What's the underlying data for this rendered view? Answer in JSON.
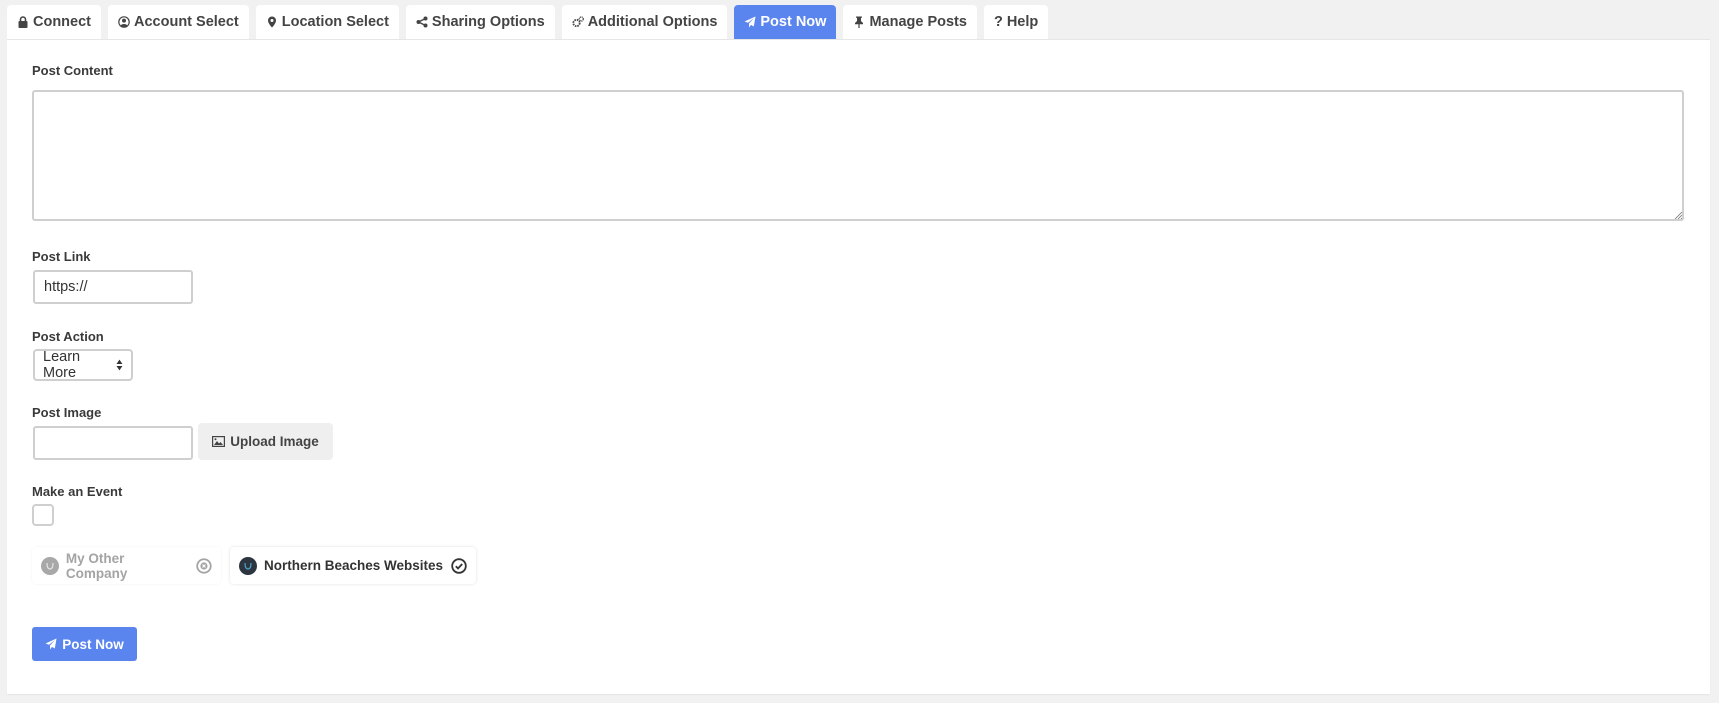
{
  "tabs": [
    {
      "label": "Connect",
      "icon": "lock-icon",
      "active": false
    },
    {
      "label": "Account Select",
      "icon": "user-circle-icon",
      "active": false
    },
    {
      "label": "Location Select",
      "icon": "map-marker-icon",
      "active": false
    },
    {
      "label": "Sharing Options",
      "icon": "share-icon",
      "active": false
    },
    {
      "label": "Additional Options",
      "icon": "cogs-icon",
      "active": false
    },
    {
      "label": "Post Now",
      "icon": "paper-plane-icon",
      "active": true
    },
    {
      "label": "Manage Posts",
      "icon": "thumbtack-icon",
      "active": false
    },
    {
      "label": "Help",
      "icon": "question-icon",
      "active": false
    }
  ],
  "form": {
    "post_content": {
      "label": "Post Content",
      "value": ""
    },
    "post_link": {
      "label": "Post Link",
      "value": "https://"
    },
    "post_action": {
      "label": "Post Action",
      "selected": "Learn More"
    },
    "post_image": {
      "label": "Post Image",
      "value": "",
      "upload_label": "Upload Image"
    },
    "make_event": {
      "label": "Make an Event",
      "checked": false
    }
  },
  "locations": [
    {
      "name": "My Other Company",
      "selected": false,
      "status_icon": "times-circle-icon"
    },
    {
      "name": "Northern Beaches Websites",
      "selected": true,
      "status_icon": "check-circle-icon"
    }
  ],
  "submit": {
    "label": "Post Now"
  },
  "colors": {
    "accent": "#5b85ee",
    "background": "#f1f1f1",
    "border": "#cfcfcf"
  }
}
